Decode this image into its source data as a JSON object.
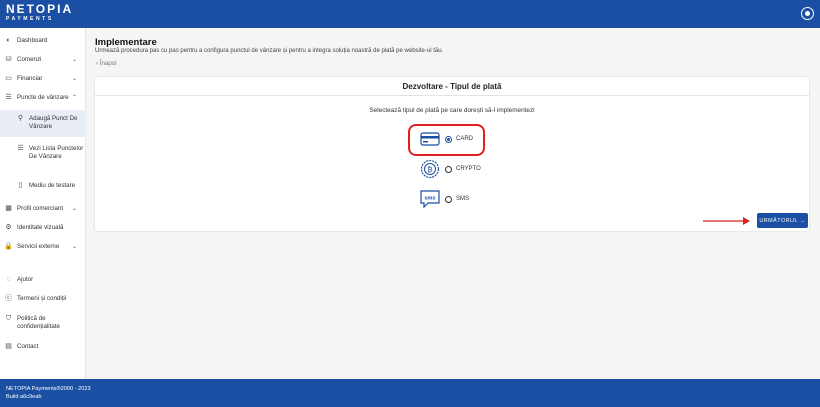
{
  "header": {
    "logo_main": "NETOPIA",
    "logo_sub": "PAYMENTS",
    "account_icon": "account-circle-icon"
  },
  "sidebar": {
    "items": [
      {
        "label": "Dashboard",
        "icon": "◐",
        "chevron": ""
      },
      {
        "label": "Comenzi",
        "icon": "⛁",
        "chevron": "⌄"
      },
      {
        "label": "Financiar",
        "icon": "▭",
        "chevron": "⌄"
      },
      {
        "label": "Puncte de vânzare",
        "icon": "☰",
        "chevron": "⌃"
      },
      {
        "label": "Adaugă Punct De Vânzare",
        "icon": "⚲",
        "chevron": ""
      },
      {
        "label": "Vezi Lista Punctelor De Vânzare",
        "icon": "☰",
        "chevron": ""
      },
      {
        "label": "Mediu de testare",
        "icon": "▯",
        "chevron": ""
      },
      {
        "label": "Profil comerciant",
        "icon": "▦",
        "chevron": "⌄"
      },
      {
        "label": "Identitate vizuală",
        "icon": "⚙",
        "chevron": ""
      },
      {
        "label": "Servicii externe",
        "icon": "🔒",
        "chevron": "⌄"
      },
      {
        "label": "Ajutor",
        "icon": "◌",
        "chevron": ""
      },
      {
        "label": "Termeni și condiții",
        "icon": "ⓒ",
        "chevron": ""
      },
      {
        "label": "Politică de confidențialitate",
        "icon": "⛉",
        "chevron": ""
      },
      {
        "label": "Contact",
        "icon": "▤",
        "chevron": ""
      }
    ]
  },
  "main": {
    "title": "Implementare",
    "subtitle": "Urmează procedura pas cu pas pentru a configura punctul de vânzare și pentru a integra soluția noastră de plată pe website-ul tău.",
    "back_label": "Înapoi"
  },
  "card": {
    "title": "Dezvoltare - Tipul de plată",
    "instruction": "Selectează tipul de plată pe care dorești să-l implementezi",
    "options": [
      {
        "label": "CARD",
        "checked": true
      },
      {
        "label": "CRYPTO",
        "checked": false
      },
      {
        "label": "SMS",
        "checked": false
      }
    ],
    "next_button": "URMĂTORUL →"
  },
  "footer": {
    "line1": "NETOPIA Payments®2000 - 2023",
    "line2": "Build a6c9eab"
  }
}
